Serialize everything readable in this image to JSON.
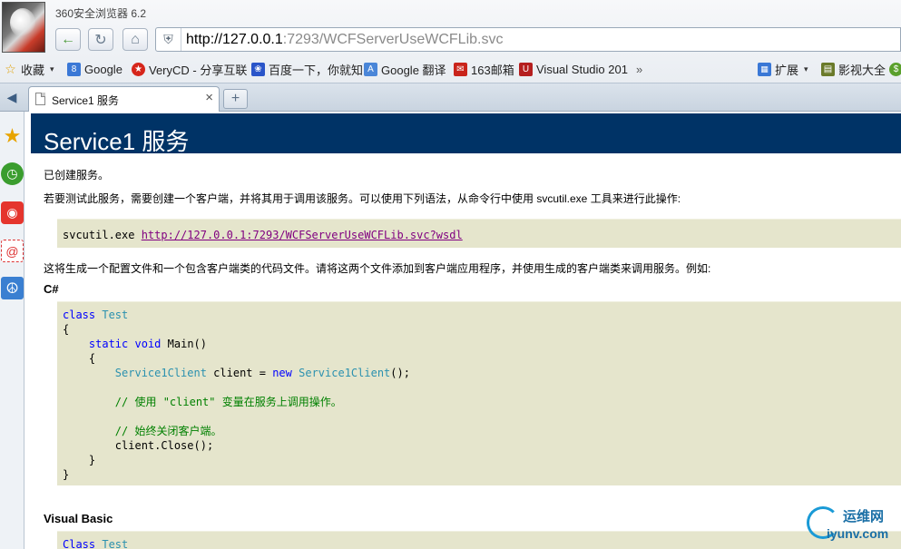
{
  "browser": {
    "app_title": "360安全浏览器 6.2",
    "address": {
      "url_host": "http://127.0.0.1",
      "url_rest": ":7293/WCFServerUseWCFLib.svc"
    },
    "bookmarks": [
      {
        "label": "收藏",
        "icon": "star-icon"
      },
      {
        "label": "Google",
        "icon": "google-icon"
      },
      {
        "label": "VeryCD - 分享互联",
        "icon": "verycd-icon"
      },
      {
        "label": "百度一下，你就知",
        "icon": "baidu-icon"
      },
      {
        "label": "Google 翻译",
        "icon": "translate-icon"
      },
      {
        "label": "163邮箱",
        "icon": "mail163-icon"
      },
      {
        "label": "Visual Studio 201",
        "icon": "vs-icon"
      },
      {
        "label": "»",
        "icon": ""
      },
      {
        "label": "扩展",
        "icon": "extensions-icon"
      },
      {
        "label": "影视大全",
        "icon": "video-icon"
      }
    ],
    "tab": {
      "label": "Service1 服务",
      "close": "×"
    },
    "new_tab": "+"
  },
  "page": {
    "title": "Service1 服务",
    "created": "已创建服务。",
    "instructions": "若要测试此服务，需要创建一个客户端，并将其用于调用该服务。可以使用下列语法，从命令行中使用 svcutil.exe 工具来进行此操作:",
    "svcutil_cmd": "svcutil.exe ",
    "svcutil_link": "http://127.0.0.1:7293/WCFServerUseWCFLib.svc?wsdl",
    "generate_note": "这将生成一个配置文件和一个包含客户端类的代码文件。请将这两个文件添加到客户端应用程序，并使用生成的客户端类来调用服务。例如:",
    "csharp_label": "C#",
    "vb_label": "Visual Basic",
    "csharp_code": {
      "l1_kw": "class",
      "l1_ty": "Test",
      "l2": "{",
      "l3_kw1": "static",
      "l3_kw2": "void",
      "l3_rest": "Main()",
      "l4": "{",
      "l5_ty1": "Service1Client",
      "l5_mid": " client = ",
      "l5_kw": "new",
      "l5_ty2": "Service1Client",
      "l5_end": "();",
      "l6_cm": "// 使用 \"client\" 变量在服务上调用操作。",
      "l7_cm": "// 始终关闭客户端。",
      "l8": "client.Close();",
      "l9": "}",
      "l10": "}"
    },
    "vb_code": {
      "l1_kw": "Class",
      "l1_ty": "Test"
    }
  },
  "watermark": {
    "line1": "运维网",
    "line2": "iyunv.com"
  }
}
